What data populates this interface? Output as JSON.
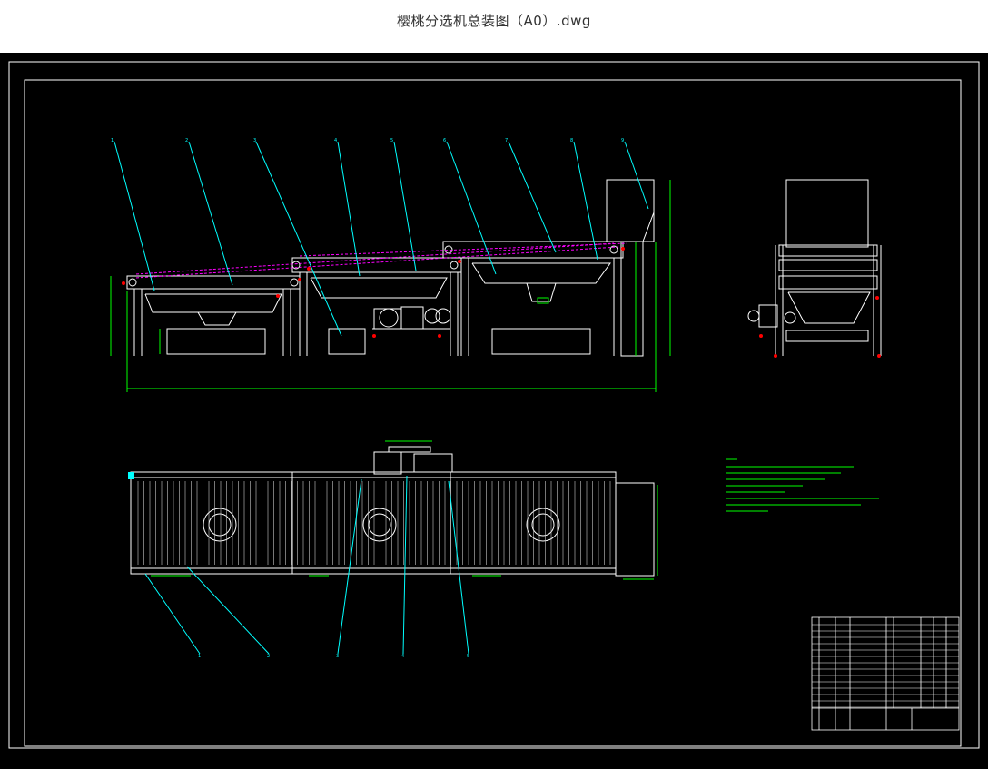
{
  "window": {
    "title": "樱桃分选机总装图（A0）.dwg"
  },
  "drawing": {
    "background_color": "#000000",
    "line_color": "#ffffff",
    "leader_color": "#00ffff",
    "dimension_color": "#00ff00",
    "hidden_line_color": "#ff00ff",
    "marker_color": "#ff0000",
    "note_color": "#00ff00",
    "top_balloons": [
      "1",
      "2",
      "3",
      "4",
      "5",
      "6",
      "7",
      "8",
      "9"
    ],
    "bottom_balloons": [
      "1",
      "2",
      "3",
      "4",
      "5"
    ]
  }
}
